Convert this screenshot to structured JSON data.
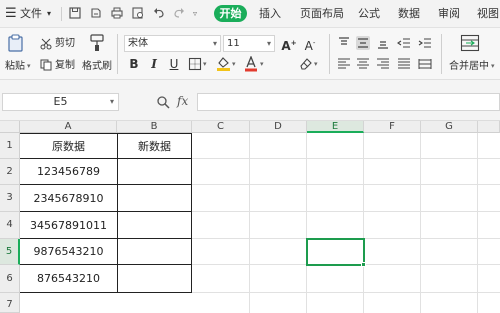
{
  "menubar": {
    "file_label": "文件",
    "tabs": [
      "开始",
      "插入",
      "页面布局",
      "公式",
      "数据",
      "审阅",
      "视图"
    ]
  },
  "ribbon": {
    "paste_label": "粘贴",
    "cut_label": "剪切",
    "copy_label": "复制",
    "format_painter_label": "格式刷",
    "font_name": "宋体",
    "font_size": "11",
    "bold_label": "B",
    "italic_label": "I",
    "underline_label": "U",
    "merge_center_label": "合并居中"
  },
  "formula_bar": {
    "name_box": "E5",
    "fx_label": "fx",
    "formula_value": ""
  },
  "grid": {
    "columns": [
      "A",
      "B",
      "C",
      "D",
      "E",
      "F",
      "G"
    ],
    "rows": [
      "1",
      "2",
      "3",
      "4",
      "5",
      "6",
      "7"
    ],
    "selected_cell": "E5",
    "selected_column": "E",
    "selected_row": "5",
    "col_a": [
      "原数据",
      "123456789",
      "2345678910",
      "34567891011",
      "9876543210",
      "876543210"
    ],
    "col_b": [
      "新数据",
      "",
      "",
      "",
      "",
      ""
    ]
  }
}
